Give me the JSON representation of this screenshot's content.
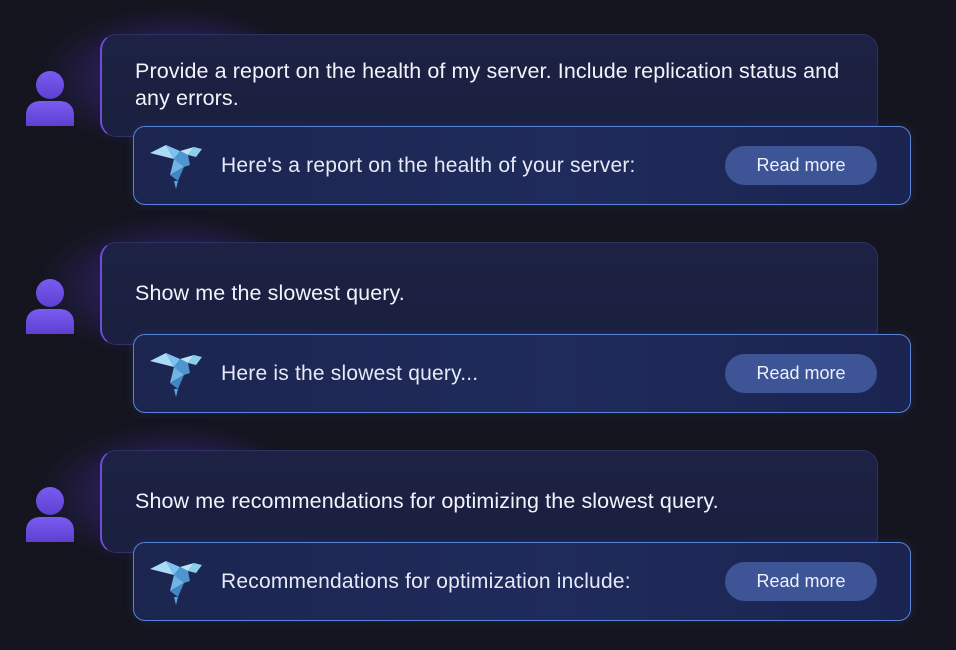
{
  "messages": [
    {
      "user_text": "Provide a report on the health of my server. Include replication status and any errors.",
      "bot_text": "Here's a report on the health of your server:",
      "button_label": "Read more"
    },
    {
      "user_text": "Show me the slowest query.",
      "bot_text": "Here is the slowest query...",
      "button_label": "Read more"
    },
    {
      "user_text": "Show me recommendations for optimizing the slowest query.",
      "bot_text": "Recommendations for optimization include:",
      "button_label": "Read more"
    }
  ],
  "icons": {
    "user": "user-avatar-icon",
    "assistant": "origami-bird-icon"
  },
  "colors": {
    "background": "#14151f",
    "user_bubble": "#1d2244",
    "bot_bubble": "#1f2b5a",
    "bot_border": "#5a83d6",
    "button": "#3d5597",
    "avatar": "#6e4fe0",
    "glow": "#7846eb"
  }
}
